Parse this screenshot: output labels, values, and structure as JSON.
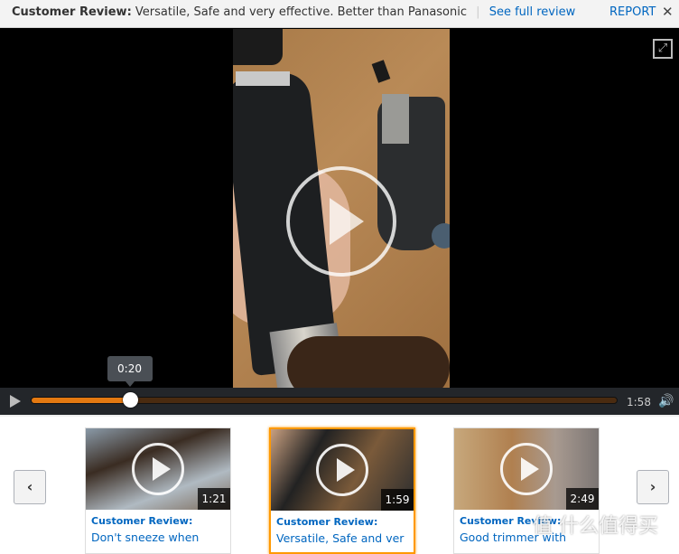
{
  "review_bar": {
    "label": "Customer Review:",
    "title": "Versatile, Safe and very effective. Better than Panasonic",
    "separator": "|",
    "see_full_link": "See full review",
    "report_link": "REPORT",
    "close_glyph": "✕"
  },
  "player": {
    "fullscreen_glyph": "⤢",
    "tooltip_time": "0:20",
    "duration": "1:58",
    "progress_fraction": 0.169,
    "volume_glyph": "🔊",
    "accent_color": "#e47911"
  },
  "carousel": {
    "prev_glyph": "‹",
    "next_glyph": "›",
    "items": [
      {
        "label": "Customer Review:",
        "title": "Don't sneeze when",
        "duration": "1:21",
        "active": false
      },
      {
        "label": "Customer Review:",
        "title": "Versatile, Safe and ver",
        "duration": "1:59",
        "active": true
      },
      {
        "label": "Customer Review:",
        "title": "Good trimmer with",
        "duration": "2:49",
        "active": false
      }
    ]
  },
  "watermark": "值 什么值得买"
}
